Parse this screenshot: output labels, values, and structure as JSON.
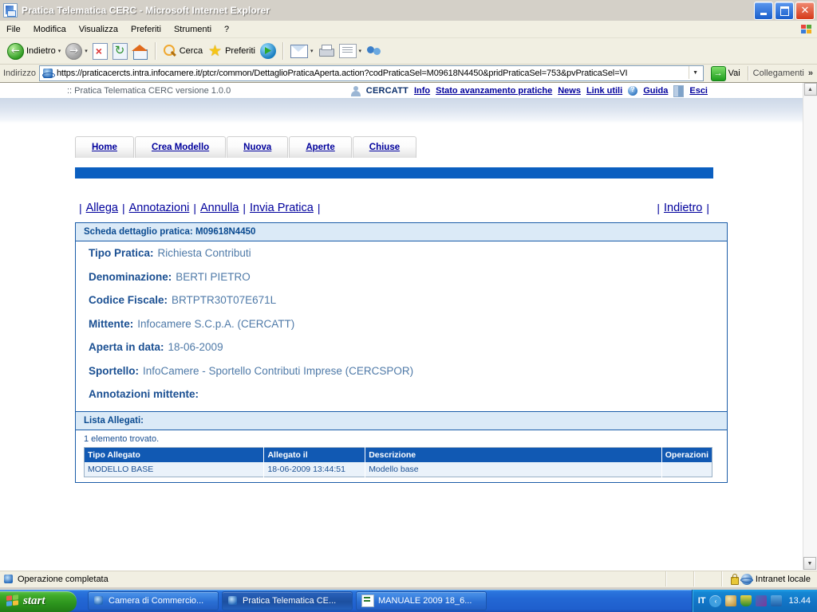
{
  "window": {
    "title": "Pratica Telematica CERC - Microsoft Internet Explorer",
    "minimize": "–",
    "maximize": "❐",
    "close": "✕"
  },
  "menubar": {
    "items": [
      "File",
      "Modifica",
      "Visualizza",
      "Preferiti",
      "Strumenti",
      "?"
    ]
  },
  "toolbar": {
    "back_label": "Indietro",
    "search_label": "Cerca",
    "favorites_label": "Preferiti",
    "caret": "▾"
  },
  "addressbar": {
    "label": "Indirizzo",
    "url": "https://praticacercts.intra.infocamere.it/ptcr/common/DettaglioPraticaAperta.action?codPraticaSel=M09618N4450&pridPraticaSel=753&pvPraticaSel=VI",
    "go_label": "Vai",
    "go_arrow": "→",
    "links_label": "Collegamenti",
    "chevron": "»",
    "dropdown": "▼"
  },
  "appheader": {
    "version": ":: Pratica Telematica CERC versione 1.0.0",
    "user": "CERCATT",
    "links": [
      {
        "label": "Info"
      },
      {
        "label": "Stato avanzamento pratiche"
      },
      {
        "label": "News"
      },
      {
        "label": "Link utili"
      },
      {
        "label": "Guida"
      },
      {
        "label": "Esci"
      }
    ]
  },
  "navtabs": [
    {
      "label": "Home"
    },
    {
      "label": "Crea Modello"
    },
    {
      "label": "Nuova"
    },
    {
      "label": "Aperte"
    },
    {
      "label": "Chiuse"
    }
  ],
  "actions": {
    "left": [
      {
        "label": "Allega"
      },
      {
        "label": "Annotazioni"
      },
      {
        "label": "Annulla"
      },
      {
        "label": "Invia Pratica"
      }
    ],
    "right": [
      {
        "label": "Indietro"
      }
    ],
    "separator": "|"
  },
  "detail": {
    "card_title": "Scheda dettaglio pratica: M09618N4450",
    "fields": [
      {
        "label": "Tipo Pratica:",
        "value": "Richiesta Contributi"
      },
      {
        "label": "Denominazione:",
        "value": "BERTI PIETRO"
      },
      {
        "label": "Codice Fiscale:",
        "value": "BRTPTR30T07E671L"
      },
      {
        "label": "Mittente:",
        "value": "Infocamere S.C.p.A. (CERCATT)"
      },
      {
        "label": "Aperta in data:",
        "value": "18-06-2009"
      },
      {
        "label": "Sportello:",
        "value": "InfoCamere - Sportello Contributi Imprese (CERCSPOR)"
      },
      {
        "label": "Annotazioni mittente:",
        "value": ""
      }
    ]
  },
  "attachments": {
    "section_title": "Lista Allegati:",
    "found_text": "1 elemento trovato.",
    "columns": [
      "Tipo Allegato",
      "Allegato il",
      "Descrizione",
      "Operazioni"
    ],
    "rows": [
      [
        "MODELLO BASE",
        "18-06-2009 13:44:51",
        "Modello base",
        ""
      ]
    ]
  },
  "scrollbar": {
    "up": "▲",
    "down": "▼"
  },
  "statusbar": {
    "text": "Operazione completata",
    "zone": "Intranet locale"
  },
  "taskbar": {
    "start_label": "start",
    "tasks": [
      {
        "label": "Camera di Commercio...",
        "icon": "ie-icon",
        "active": false
      },
      {
        "label": "Pratica Telematica CE...",
        "icon": "ie-icon",
        "active": true
      },
      {
        "label": "MANUALE 2009 18_6...",
        "icon": "doc-icon",
        "active": false
      }
    ],
    "lang": "IT",
    "clock": "13.44",
    "tray_chevron": "‹"
  },
  "colors": {
    "accent_blue": "#0b5fc0",
    "link_blue": "#00009c",
    "label_blue": "#1a4f92",
    "value_blue": "#4f7aa8",
    "table_header": "#1159b3",
    "panel_bg": "#dbeaf7"
  }
}
